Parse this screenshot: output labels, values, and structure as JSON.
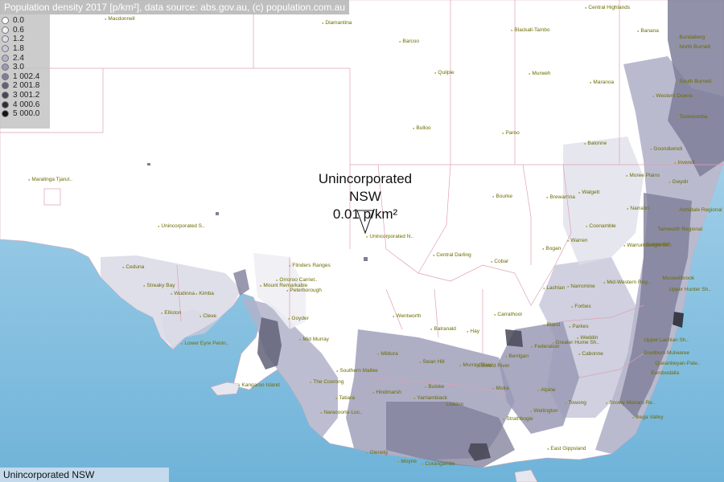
{
  "header": {
    "title": "Population density 2017 [p/km²], data source: abs.gov.au, (c) population.com.au"
  },
  "legend": {
    "items": [
      {
        "label": "0.0",
        "color": "#ffffff"
      },
      {
        "label": "0.6",
        "color": "#eeeef4"
      },
      {
        "label": "1.2",
        "color": "#dcdce8"
      },
      {
        "label": "1.8",
        "color": "#c8c8da"
      },
      {
        "label": "2.4",
        "color": "#b2b2ca"
      },
      {
        "label": "3.0",
        "color": "#9a9ab6"
      },
      {
        "label": "1 002.4",
        "color": "#7e7e9a"
      },
      {
        "label": "2 001.8",
        "color": "#626278"
      },
      {
        "label": "3 001.2",
        "color": "#484858"
      },
      {
        "label": "4 000.6",
        "color": "#2e2e38"
      },
      {
        "label": "5 000.0",
        "color": "#141418"
      }
    ]
  },
  "callout": {
    "name": "Unincorporated NSW",
    "value": "0.01 p/km²"
  },
  "footer": {
    "label": "Unincorporated NSW"
  },
  "places": [
    {
      "name": "Diamantina"
    },
    {
      "name": "Barcoo"
    },
    {
      "name": "Quilpie"
    },
    {
      "name": "Bulloo"
    },
    {
      "name": "Paroo"
    },
    {
      "name": "Murweh"
    },
    {
      "name": "Maranoa"
    },
    {
      "name": "Balonne"
    },
    {
      "name": "Blackall-Tambo"
    },
    {
      "name": "Central Highlands"
    },
    {
      "name": "Banana"
    },
    {
      "name": "Western Downs"
    },
    {
      "name": "Goondiwindi"
    },
    {
      "name": "Moree Plains"
    },
    {
      "name": "Bourke"
    },
    {
      "name": "Brewarrina"
    },
    {
      "name": "Walgett"
    },
    {
      "name": "Narrabri"
    },
    {
      "name": "Coonamble"
    },
    {
      "name": "Warren"
    },
    {
      "name": "Bogan"
    },
    {
      "name": "Cobar"
    },
    {
      "name": "Central Darling"
    },
    {
      "name": "Unincorporated N.."
    },
    {
      "name": "Unincorporated S.."
    },
    {
      "name": "Maralinga Tjarut.."
    },
    {
      "name": "Wentworth"
    },
    {
      "name": "Balranald"
    },
    {
      "name": "Carrathool"
    },
    {
      "name": "Hay"
    },
    {
      "name": "Lachlan"
    },
    {
      "name": "Bland"
    },
    {
      "name": "Ceduna"
    },
    {
      "name": "Streaky Bay"
    },
    {
      "name": "Wudinna"
    },
    {
      "name": "Kimba"
    },
    {
      "name": "Elliston"
    },
    {
      "name": "Cleve"
    },
    {
      "name": "Lower Eyre Penin.."
    },
    {
      "name": "Flinders Ranges"
    },
    {
      "name": "Orroroo Carriet.."
    },
    {
      "name": "Mount Remarkable"
    },
    {
      "name": "Peterborough"
    },
    {
      "name": "Goyder"
    },
    {
      "name": "Mid Murray"
    },
    {
      "name": "Southern Mallee"
    },
    {
      "name": "Kangaroo Island"
    },
    {
      "name": "The Coorong"
    },
    {
      "name": "Tatiara"
    },
    {
      "name": "Naracoorte Luc.."
    },
    {
      "name": "Mildura"
    },
    {
      "name": "Swan Hill"
    },
    {
      "name": "Murray River"
    },
    {
      "name": "Edward River"
    },
    {
      "name": "Hindmarsh"
    },
    {
      "name": "Yarriambiack"
    },
    {
      "name": "Buloke"
    },
    {
      "name": "Loddon"
    },
    {
      "name": "Glenelg"
    },
    {
      "name": "Moyne"
    },
    {
      "name": "Corangamite"
    },
    {
      "name": "Wellington"
    },
    {
      "name": "East Gippsland"
    },
    {
      "name": "Towong"
    },
    {
      "name": "Snowy Monaro Re.."
    },
    {
      "name": "Bega Valley"
    },
    {
      "name": "Eurobodalla"
    },
    {
      "name": "Queanbeyan-Pale.."
    },
    {
      "name": "Upper Lachlan Sh.."
    },
    {
      "name": "Goulburn Mulwaree"
    },
    {
      "name": "Cabonne"
    },
    {
      "name": "Parkes"
    },
    {
      "name": "Forbes"
    },
    {
      "name": "Weddin"
    },
    {
      "name": "Narromine"
    },
    {
      "name": "Mid-Western Reg.."
    },
    {
      "name": "Muswellbrook"
    },
    {
      "name": "Upper Hunter Sh.."
    },
    {
      "name": "Warrumbungle Sh.."
    },
    {
      "name": "Gunnedah"
    },
    {
      "name": "Tamworth Regional"
    },
    {
      "name": "Armidale Regional"
    },
    {
      "name": "Gwydir"
    },
    {
      "name": "Inverell"
    },
    {
      "name": "Toowoomba"
    },
    {
      "name": "South Burnett"
    },
    {
      "name": "North Burnett"
    },
    {
      "name": "Bundaberg"
    },
    {
      "name": "Macdonnell"
    },
    {
      "name": "Greater Hume Sh.."
    },
    {
      "name": "Federation"
    },
    {
      "name": "Berrigan"
    },
    {
      "name": "Moira"
    },
    {
      "name": "Strathbogie"
    },
    {
      "name": "Alpine"
    }
  ]
}
